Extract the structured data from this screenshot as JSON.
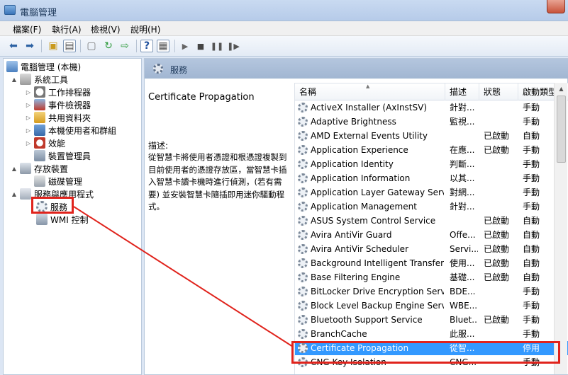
{
  "window": {
    "title": "電腦管理"
  },
  "menu": [
    "檔案(F)",
    "執行(A)",
    "檢視(V)",
    "說明(H)"
  ],
  "toolbar_icons": [
    "back-arrow-icon",
    "forward-arrow-icon",
    "up-folder-icon",
    "show-tree-icon",
    "properties-icon",
    "refresh-icon",
    "export-icon",
    "help-icon",
    "console-icon",
    "play-icon",
    "stop-icon",
    "pause-icon",
    "restart-icon"
  ],
  "tree": [
    {
      "label": "電腦管理 (本機)",
      "arrow": "",
      "icon": "computer-icon"
    },
    {
      "label": "系統工具",
      "arrow": "▲",
      "icon": "tools-icon"
    },
    {
      "label": "工作排程器",
      "arrow": "▷",
      "icon": "clock-icon"
    },
    {
      "label": "事件檢視器",
      "arrow": "▷",
      "icon": "event-viewer-icon"
    },
    {
      "label": "共用資料夾",
      "arrow": "▷",
      "icon": "shared-folder-icon"
    },
    {
      "label": "本機使用者和群組",
      "arrow": "▷",
      "icon": "users-icon"
    },
    {
      "label": "效能",
      "arrow": "▷",
      "icon": "performance-icon"
    },
    {
      "label": "裝置管理員",
      "arrow": "",
      "icon": "device-manager-icon"
    },
    {
      "label": "存放裝置",
      "arrow": "▲",
      "icon": "storage-icon"
    },
    {
      "label": "磁碟管理",
      "arrow": "",
      "icon": "disk-icon"
    },
    {
      "label": "服務與應用程式",
      "arrow": "▲",
      "icon": "services-apps-icon"
    },
    {
      "label": "服務",
      "arrow": "",
      "icon": "gear-icon"
    },
    {
      "label": "WMI 控制",
      "arrow": "",
      "icon": "wmi-icon"
    }
  ],
  "services_panel": {
    "header": "服務",
    "selected_name": "Certificate Propagation",
    "desc_label": "描述:",
    "description": "從智慧卡將使用者憑證和根憑證複製到目前使用者的憑證存放區，當智慧卡插入智慧卡讀卡機時進行偵測，(若有需要) 並安裝智慧卡隨插即用迷你驅動程式。"
  },
  "columns": [
    "名稱",
    "描述",
    "狀態",
    "啟動類型"
  ],
  "services": [
    {
      "name": "ActiveX Installer (AxInstSV)",
      "desc": "針對...",
      "status": "",
      "startup": "手動"
    },
    {
      "name": "Adaptive Brightness",
      "desc": "監視...",
      "status": "",
      "startup": "手動"
    },
    {
      "name": "AMD External Events Utility",
      "desc": "",
      "status": "已啟動",
      "startup": "自動"
    },
    {
      "name": "Application Experience",
      "desc": "在應...",
      "status": "已啟動",
      "startup": "手動"
    },
    {
      "name": "Application Identity",
      "desc": "判斷...",
      "status": "",
      "startup": "手動"
    },
    {
      "name": "Application Information",
      "desc": "以其...",
      "status": "",
      "startup": "手動"
    },
    {
      "name": "Application Layer Gateway Serv...",
      "desc": "對網...",
      "status": "",
      "startup": "手動"
    },
    {
      "name": "Application Management",
      "desc": "針對...",
      "status": "",
      "startup": "手動"
    },
    {
      "name": "ASUS System Control Service",
      "desc": "",
      "status": "已啟動",
      "startup": "自動"
    },
    {
      "name": "Avira AntiVir Guard",
      "desc": "Offe...",
      "status": "已啟動",
      "startup": "自動"
    },
    {
      "name": "Avira AntiVir Scheduler",
      "desc": "Servi...",
      "status": "已啟動",
      "startup": "自動"
    },
    {
      "name": "Background Intelligent Transfer ...",
      "desc": "使用...",
      "status": "已啟動",
      "startup": "自動"
    },
    {
      "name": "Base Filtering Engine",
      "desc": "基礎...",
      "status": "已啟動",
      "startup": "自動"
    },
    {
      "name": "BitLocker Drive Encryption Servi...",
      "desc": "BDE...",
      "status": "",
      "startup": "手動"
    },
    {
      "name": "Block Level Backup Engine Servi...",
      "desc": "WBE...",
      "status": "",
      "startup": "手動"
    },
    {
      "name": "Bluetooth Support Service",
      "desc": "Bluet...",
      "status": "已啟動",
      "startup": "手動"
    },
    {
      "name": "BranchCache",
      "desc": "此服...",
      "status": "",
      "startup": "手動"
    },
    {
      "name": "Certificate Propagation",
      "desc": "從智...",
      "status": "",
      "startup": "停用",
      "selected": true
    },
    {
      "name": "CNG Key Isolation",
      "desc": "CNG...",
      "status": "",
      "startup": "手動"
    }
  ]
}
